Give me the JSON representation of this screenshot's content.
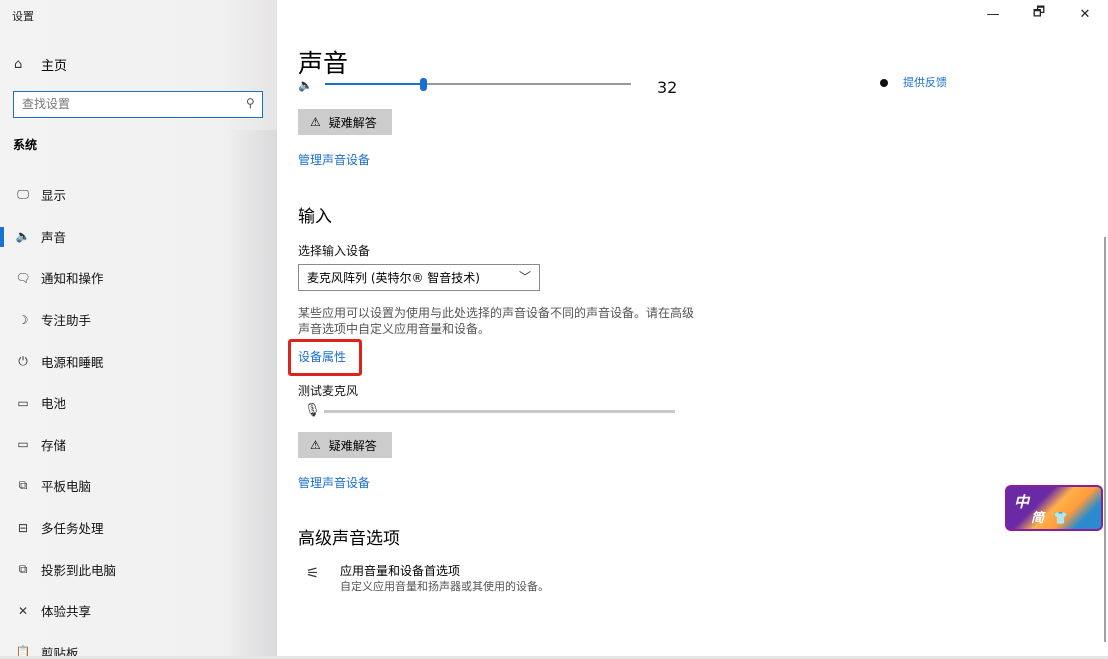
{
  "window": {
    "title": "设置",
    "minimize_icon": "—",
    "restore_icon": "🗗",
    "close_icon": "✕"
  },
  "sidebar": {
    "home": {
      "icon": "⌂",
      "label": "主页"
    },
    "search": {
      "placeholder": "查找设置",
      "value": ""
    },
    "section": "系统",
    "items": [
      {
        "icon": "🖵",
        "label": "显示",
        "active": false
      },
      {
        "icon": "🔈",
        "label": "声音",
        "active": true
      },
      {
        "icon": "🗨",
        "label": "通知和操作",
        "active": false
      },
      {
        "icon": "☽",
        "label": "专注助手",
        "active": false
      },
      {
        "icon": "⏻",
        "label": "电源和睡眠",
        "active": false
      },
      {
        "icon": "▭",
        "label": "电池",
        "active": false
      },
      {
        "icon": "▭",
        "label": "存储",
        "active": false
      },
      {
        "icon": "⧉",
        "label": "平板电脑",
        "active": false
      },
      {
        "icon": "⊟",
        "label": "多任务处理",
        "active": false
      },
      {
        "icon": "⧉",
        "label": "投影到此电脑",
        "active": false
      },
      {
        "icon": "✕",
        "label": "体验共享",
        "active": false
      },
      {
        "icon": "📋",
        "label": "剪贴板",
        "active": false
      }
    ]
  },
  "main": {
    "title": "声音",
    "output": {
      "volume": 32,
      "volume_fraction": 0.32,
      "feedback_link": "提供反馈",
      "troubleshoot_label": "疑难解答",
      "manage_devices_link": "管理声音设备"
    },
    "input": {
      "heading": "输入",
      "select_label": "选择输入设备",
      "selected_device": "麦克风阵列 (英特尔® 智音技术)",
      "description": "某些应用可以设置为使用与此处选择的声音设备不同的声音设备。请在高级声音选项中自定义应用音量和设备。",
      "device_properties_link": "设备属性",
      "test_mic_label": "测试麦克风",
      "mic_level_fraction": 0.0,
      "troubleshoot_label": "疑难解答",
      "manage_devices_link": "管理声音设备"
    },
    "advanced": {
      "heading": "高级声音选项",
      "item_title": "应用音量和设备首选项",
      "item_subtitle": "自定义应用音量和扬声器或其使用的设备。"
    }
  },
  "ime": {
    "mode": "中",
    "variant": "简"
  },
  "colors": {
    "accent": "#1a6fd0",
    "highlight": "#e0231a"
  }
}
